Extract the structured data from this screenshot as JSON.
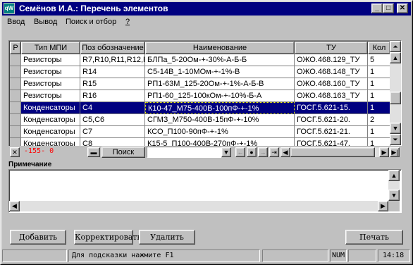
{
  "window": {
    "title": "Семёнов И.А.: Перечень элементов",
    "icon_label": "qW",
    "minimize_glyph": "_",
    "maximize_glyph": "□",
    "close_glyph": "✕"
  },
  "menu": [
    "Ввод",
    "Вывод",
    "Поиск и отбор",
    "?"
  ],
  "table": {
    "columns": [
      "Р",
      "Тип МПИ",
      "Поз обозначение",
      "Наименование",
      "ТУ",
      "Кол"
    ],
    "rows": [
      [
        "",
        "Резисторы",
        "R7,R10,R11,R12,R",
        "БЛПа_5-20Ом-+-30%-А-Б-Б",
        "ОЖО.468.129_ТУ",
        "5"
      ],
      [
        "",
        "Резисторы",
        "R14",
        "С5-14В_1-10МОм-+-1%-В",
        "ОЖО.468.148_ТУ",
        "1"
      ],
      [
        "",
        "Резисторы",
        "R15",
        "РП1-63М_125-20Ом-+-1%-А-Б-В",
        "ОЖО.468.160_ТУ",
        "1"
      ],
      [
        "",
        "Резисторы",
        "R16",
        "РП1-60_125-100кОм-+-10%-Б-А",
        "ОЖО.468.163_ТУ",
        "1"
      ],
      [
        "",
        "Конденсаторы",
        "C4",
        "К10-47_М75-400В-100пФ-+-1%",
        "ГОСГ.5.621-15.",
        "1"
      ],
      [
        "",
        "Конденсаторы",
        "C5,C6",
        "СГМЗ_М750-400В-15пФ-+-10%",
        "ГОСГ.5.621-20.",
        "2"
      ],
      [
        "",
        "Конденсаторы",
        "C7",
        "КСО_П100-90пФ-+-1%",
        "ГОСГ.5.621-21.",
        "1"
      ],
      [
        "",
        "Конденсаторы",
        "C8",
        "К15-5_П100-400В-270пФ-+-1%",
        "ГОСГ.5.621-47.",
        "1"
      ]
    ],
    "selected_row": 4
  },
  "navigator": {
    "record_indicator": "-155- 0",
    "search_label": "Поиск",
    "search_value": "",
    "nav_prev": "←",
    "nav_dot": "●",
    "nav_next": "→",
    "nav_last": "⇥"
  },
  "notes": {
    "label": "Примечание",
    "value": ""
  },
  "buttons": {
    "add": "Добавить",
    "edit": "Корректировать",
    "delete": "Удалить",
    "print": "Печать"
  },
  "status": {
    "hint": "Для подсказки нажмите F1",
    "num": "NUM",
    "time": "14:18"
  },
  "colors": {
    "title_bar": "#000080",
    "selection": "#000080",
    "record_indicator": "#ff0000"
  }
}
